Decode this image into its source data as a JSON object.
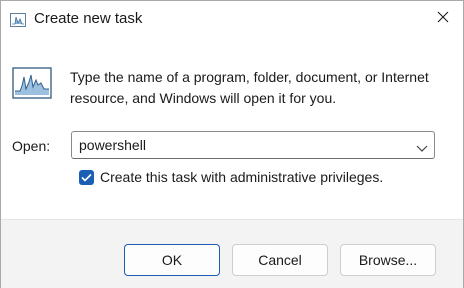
{
  "window": {
    "title": "Create new task",
    "icon": "task-manager-icon",
    "close_icon": "close-icon"
  },
  "dialog": {
    "instruction": "Type the name of a program, folder, document, or Internet resource, and Windows will open it for you.",
    "open_label": "Open:",
    "open_value": "powershell",
    "admin_checkbox_label": "Create this task with administrative privileges.",
    "admin_checkbox_checked": true
  },
  "buttons": {
    "ok": "OK",
    "cancel": "Cancel",
    "browse": "Browse..."
  },
  "colors": {
    "accent": "#1a5fb4",
    "footer_bg": "#f3f3f3"
  }
}
